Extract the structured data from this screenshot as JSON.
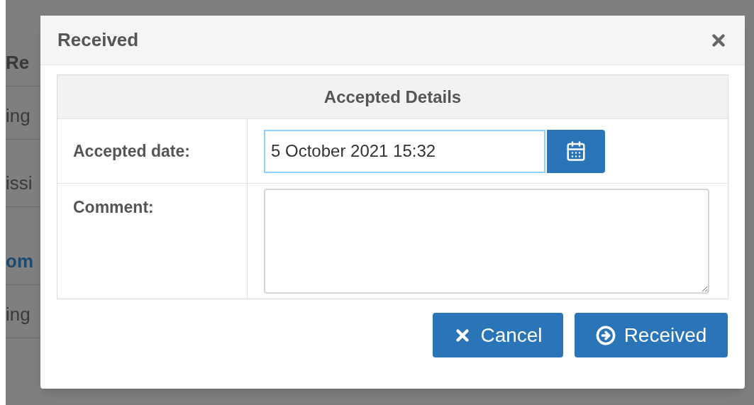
{
  "background": {
    "rows": [
      {
        "text": "Re",
        "kind": "heading"
      },
      {
        "text": "ing",
        "kind": "plain"
      },
      {
        "text": "issi",
        "kind": "plain"
      },
      {
        "text": "om",
        "kind": "link"
      },
      {
        "text": "ing",
        "kind": "plain"
      }
    ]
  },
  "dialog": {
    "title": "Received",
    "section_title": "Accepted Details",
    "fields": [
      {
        "label": "Accepted date:",
        "kind": "date",
        "value": "5 October 2021 15:32",
        "focused": true
      },
      {
        "label": "Comment:",
        "kind": "textarea"
      }
    ],
    "buttons": [
      {
        "label": "Cancel",
        "kind": "cancel"
      },
      {
        "label": "Received",
        "kind": "submit"
      }
    ]
  }
}
